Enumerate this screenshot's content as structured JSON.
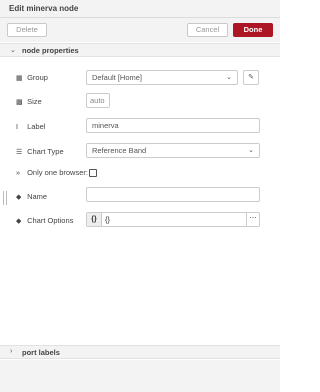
{
  "tray": {
    "title": "Edit minerva node"
  },
  "toolbar": {
    "delete_label": "Delete",
    "cancel_label": "Cancel",
    "done_label": "Done"
  },
  "sections": {
    "node_properties": "node properties",
    "port_labels": "port labels"
  },
  "form": {
    "group": {
      "label": "Group",
      "value": "Default [Home]"
    },
    "size": {
      "label": "Size",
      "value": "auto"
    },
    "label_field": {
      "label": "Label",
      "value": "minerva"
    },
    "chart_type": {
      "label": "Chart Type",
      "value": "Reference Band"
    },
    "only_one_browser": {
      "label": "Only one browser:",
      "checked": false
    },
    "name": {
      "label": "Name",
      "value": ""
    },
    "chart_options": {
      "label": "Chart Options",
      "badge": "{}",
      "value": "{}"
    }
  },
  "icons": {
    "group": "table-icon",
    "size": "grid-icon",
    "label": "text-cursor-icon",
    "chart_type": "list-icon",
    "only_one_browser": "fast-forward-icon",
    "name": "tag-icon",
    "chart_options": "tag-icon",
    "edit": "pencil-icon"
  },
  "colors": {
    "done_button": "#ad1625",
    "header_bg": "#f3f3f3"
  }
}
